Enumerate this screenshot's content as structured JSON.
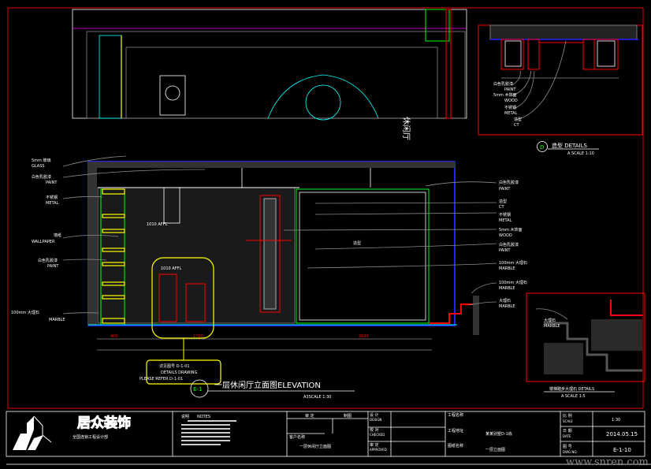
{
  "top_plan": {
    "room_label": "休闲厅"
  },
  "detail_a": {
    "labels": [
      {
        "cn": "白色乳胶漆",
        "en": "PAINT"
      },
      {
        "cn": "5mm 木饰面",
        "en": "WOOD"
      },
      {
        "cn": "不锈钢",
        "en": "METAL"
      },
      {
        "cn": "造型",
        "en": "CT"
      }
    ],
    "marker": "D",
    "title": "造型 DETAILS",
    "scale": "A SCALE 1:10"
  },
  "elevation": {
    "left_labels": [
      {
        "cn": "5mm 玻璃",
        "en": "GLASS"
      },
      {
        "cn": "白色乳胶漆",
        "en": "PAINT"
      },
      {
        "cn": "不锈钢",
        "en": "METAL"
      },
      {
        "cn": "墙纸",
        "en": "WALLPAPER"
      },
      {
        "cn": "白色乳胶漆",
        "en": "PAINT"
      },
      {
        "cn": "100mm 大理石",
        "en": "MARBLE"
      }
    ],
    "right_labels": [
      {
        "cn": "白色乳胶漆",
        "en": "PAINT"
      },
      {
        "cn": "造型",
        "en": "CT"
      },
      {
        "cn": "不锈钢",
        "en": "METAL"
      },
      {
        "cn": "5mm 木饰面",
        "en": "WOOD"
      },
      {
        "cn": "白色乳胶漆",
        "en": "PAINT"
      },
      {
        "cn": "100mm 大理石",
        "en": "MARBLE"
      },
      {
        "cn": "100mm 大理石",
        "en": "MARBLE"
      },
      {
        "cn": "大理石",
        "en": "MARBLE"
      }
    ],
    "affl_1": "1010 AFFL",
    "affl_2": "1010 AFFL",
    "center_label": "造型",
    "dims": [
      "400",
      "1700",
      "2690"
    ],
    "callout": {
      "line1": "详见图号 D-1-01",
      "line2": "DETAILS DRAWING",
      "line3": "PLEASE REFER D-1-01"
    },
    "marker": "E-1",
    "title": "一层休闲厅立面图ELEVATION",
    "scale": "A3SCALE 1:30"
  },
  "detail_b": {
    "labels": [
      {
        "cn": "大理石",
        "en": "MARBLE"
      }
    ],
    "title": "楼梯踏步大理石 DETAILS",
    "scale": "A SCALE 1:5"
  },
  "title_block": {
    "company": "居众装饰",
    "company_sub": "全国连锁工程设计部",
    "notes_title": "说明",
    "notes_label": "NOTES",
    "col_a": "审 定",
    "col_b": "制图",
    "project_label": "工程名称",
    "drawing_name": "一层休闲厅立面图",
    "designer_cn": "设 计",
    "designer_en": "DESIGN",
    "checker_cn": "校 对",
    "checker_en": "CHECKED",
    "approve_cn": "审 定",
    "approve_en": "APPROVED",
    "client_label": "客户名称",
    "address_label": "工程地址",
    "address_value": "某某别墅D-1栋",
    "drawing_label": "图纸名称",
    "drawing_value": "一层立面图",
    "scale_cn": "比 例",
    "scale_en": "SCALE",
    "scale_value": "1:30",
    "date_cn": "日 期",
    "date_en": "DATE",
    "date_value": "2014.05.15",
    "dwg_cn": "图 号",
    "dwg_en": "DWG NO.",
    "dwg_value": "E-1-10"
  },
  "watermark": "www.snren.com"
}
